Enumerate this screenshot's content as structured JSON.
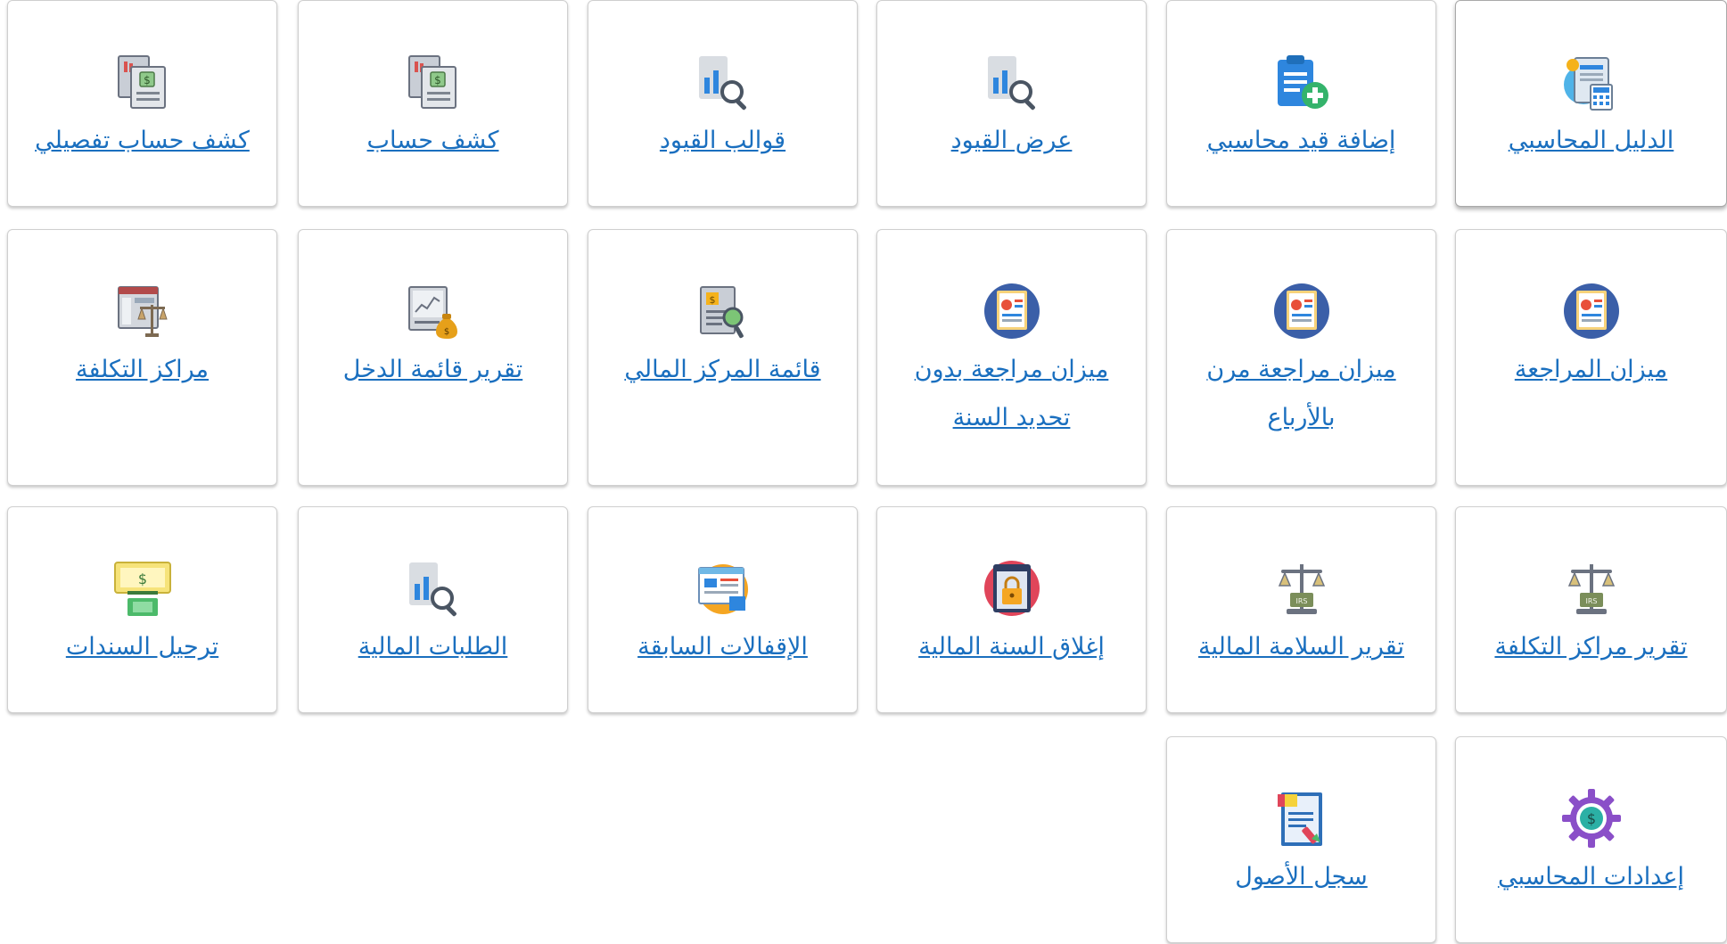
{
  "tiles": [
    {
      "label": "الدليل المحاسبي",
      "icon": "accounting-guide-icon"
    },
    {
      "label": "إضافة قيد محاسبي",
      "icon": "add-clipboard-icon"
    },
    {
      "label": "عرض القيود",
      "icon": "chart-search-icon"
    },
    {
      "label": "قوالب القيود",
      "icon": "chart-search-icon"
    },
    {
      "label": "كشف حساب",
      "icon": "statement-docs-icon"
    },
    {
      "label": "كشف حساب تفصيلي",
      "icon": "statement-docs-icon"
    },
    {
      "label": "ميزان المراجعة",
      "icon": "report-circle-icon"
    },
    {
      "label": "ميزان مراجعة مرن بالأرباع",
      "icon": "report-circle-icon"
    },
    {
      "label": "ميزان مراجعة بدون تحديد السنة",
      "icon": "report-circle-icon"
    },
    {
      "label": "قائمة المركز المالي",
      "icon": "financial-position-icon"
    },
    {
      "label": "تقرير قائمة الدخل",
      "icon": "income-statement-icon"
    },
    {
      "label": "مراكز التكلفة",
      "icon": "cost-center-scale-icon"
    },
    {
      "label": "تقرير مراكز التكلفة",
      "icon": "irs-scale-icon"
    },
    {
      "label": "تقرير السلامة المالية",
      "icon": "irs-scale-icon"
    },
    {
      "label": "إغلاق السنة المالية",
      "icon": "lock-circle-icon"
    },
    {
      "label": "الإقفالات السابقة",
      "icon": "dashboard-circle-icon"
    },
    {
      "label": "الطلبات المالية",
      "icon": "chart-search-icon"
    },
    {
      "label": "ترحيل السندات",
      "icon": "money-transfer-icon"
    },
    {
      "label": "إعدادات المحاسبي",
      "icon": "dollar-gear-icon"
    },
    {
      "label": "سجل الأصول",
      "icon": "asset-register-icon"
    }
  ],
  "colors": {
    "link": "#1a6fbf",
    "border": "#cfcfcf"
  }
}
